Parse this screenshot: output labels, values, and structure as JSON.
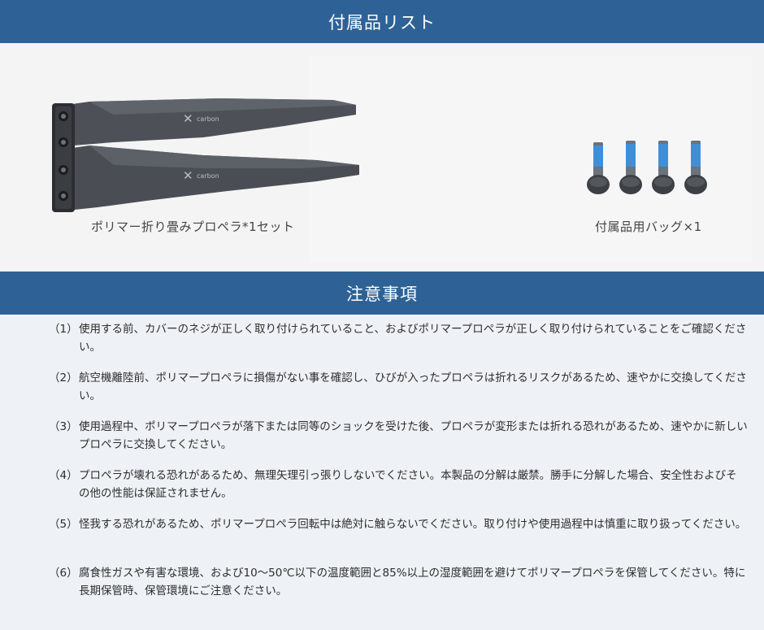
{
  "section1": {
    "title": "付属品リスト"
  },
  "accessories": {
    "left_caption": "ポリマー折り畳みプロペラ*1セット",
    "right_caption": "付属品用バッグ×1",
    "logo_text": "carbon"
  },
  "section2": {
    "title": "注意事項"
  },
  "notes": [
    {
      "num": "（1）",
      "text": "使用する前、カバーのネジが正しく取り付けられていること、およびポリマープロペラが正しく取り付けられていることをご確認ください。"
    },
    {
      "num": "（2）",
      "text": "航空機離陸前、ポリマープロペラに損傷がない事を確認し、ひびが入ったプロペラは折れるリスクがあるため、速やかに交換してください。"
    },
    {
      "num": "（3）",
      "text": "使用過程中、ポリマープロペラが落下または同等のショックを受けた後、プロペラが変形または折れる恐れがあるため、速やかに新しいプロペラに交換してください。"
    },
    {
      "num": "（4）",
      "text": "プロペラが壊れる恐れがあるため、無理矢理引っ張りしないでください。本製品の分解は厳禁。勝手に分解した場合、安全性およびその他の性能は保証されません。"
    },
    {
      "num": "（5）",
      "text": "怪我する恐れがあるため、ポリマープロペラ回転中は絶対に触らないでください。取り付けや使用過程中は慎重に取り扱ってください。"
    },
    {
      "num": "（6）",
      "text": "腐食性ガスや有害な環境、および10～50℃以下の温度範囲と85%以上の湿度範囲を避けてポリマープロペラを保管してください。特に長期保管時、保管環境にご注意ください。"
    }
  ]
}
